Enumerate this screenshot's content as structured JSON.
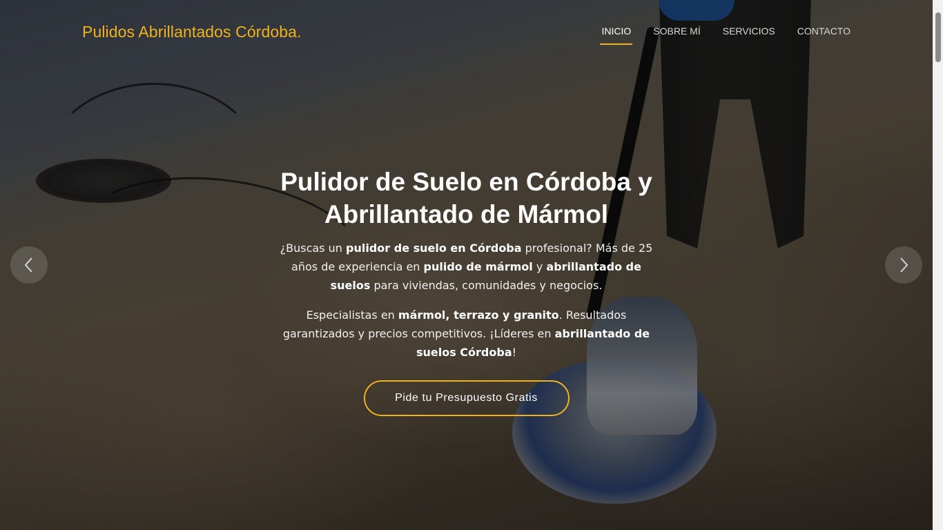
{
  "header": {
    "brand": "Pulidos Abrillantados Córdoba",
    "brand_dot": ".",
    "nav": [
      {
        "label": "INICIO",
        "active": true
      },
      {
        "label": "SOBRE MÍ",
        "active": false
      },
      {
        "label": "SERVICIOS",
        "active": false
      },
      {
        "label": "CONTACTO",
        "active": false
      }
    ]
  },
  "hero": {
    "title_line1": "Pulidor de Suelo en Córdoba y",
    "title_line2": "Abrillantado de Mármol",
    "p1": {
      "t1": "¿Buscas un ",
      "b1": "pulidor de suelo en Córdoba",
      "t2": " profesional? Más de 25 años de experiencia en ",
      "b2": "pulido de mármol",
      "t3": " y ",
      "b3": "abrillantado de suelos",
      "t4": " para viviendas, comunidades y negocios."
    },
    "p2": {
      "t1": "Especialistas en ",
      "b1": "mármol, terrazo y granito",
      "t2": ". Resultados garantizados y precios competitivos. ¡Líderes en ",
      "b2": "abrillantado de suelos Córdoba",
      "t3": "!"
    },
    "cta_label": "Pide tu Presupuesto Gratis"
  },
  "carousel": {
    "prev_icon": "chevron-left-icon",
    "next_icon": "chevron-right-icon"
  },
  "colors": {
    "accent": "#f2b21b",
    "text": "#ffffff",
    "nav_text": "#d8d8d8"
  }
}
